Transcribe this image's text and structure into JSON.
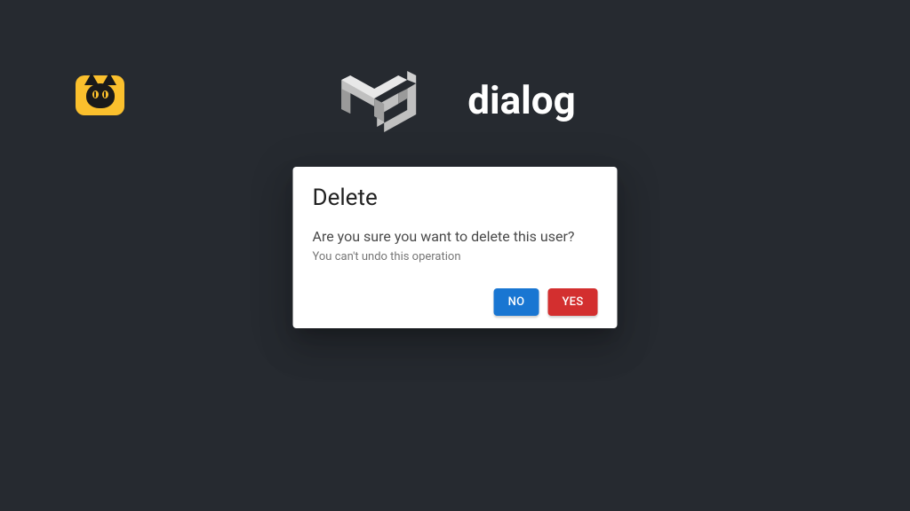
{
  "header": {
    "title": "dialog"
  },
  "dialog": {
    "title": "Delete",
    "message": "Are you sure you want to delete this user?",
    "subtext": "You can't undo this operation",
    "no_label": "NO",
    "yes_label": "YES"
  },
  "colors": {
    "background": "#262a30",
    "primary": "#1976d2",
    "danger": "#d32f2f",
    "badge": "#fbc02d"
  }
}
